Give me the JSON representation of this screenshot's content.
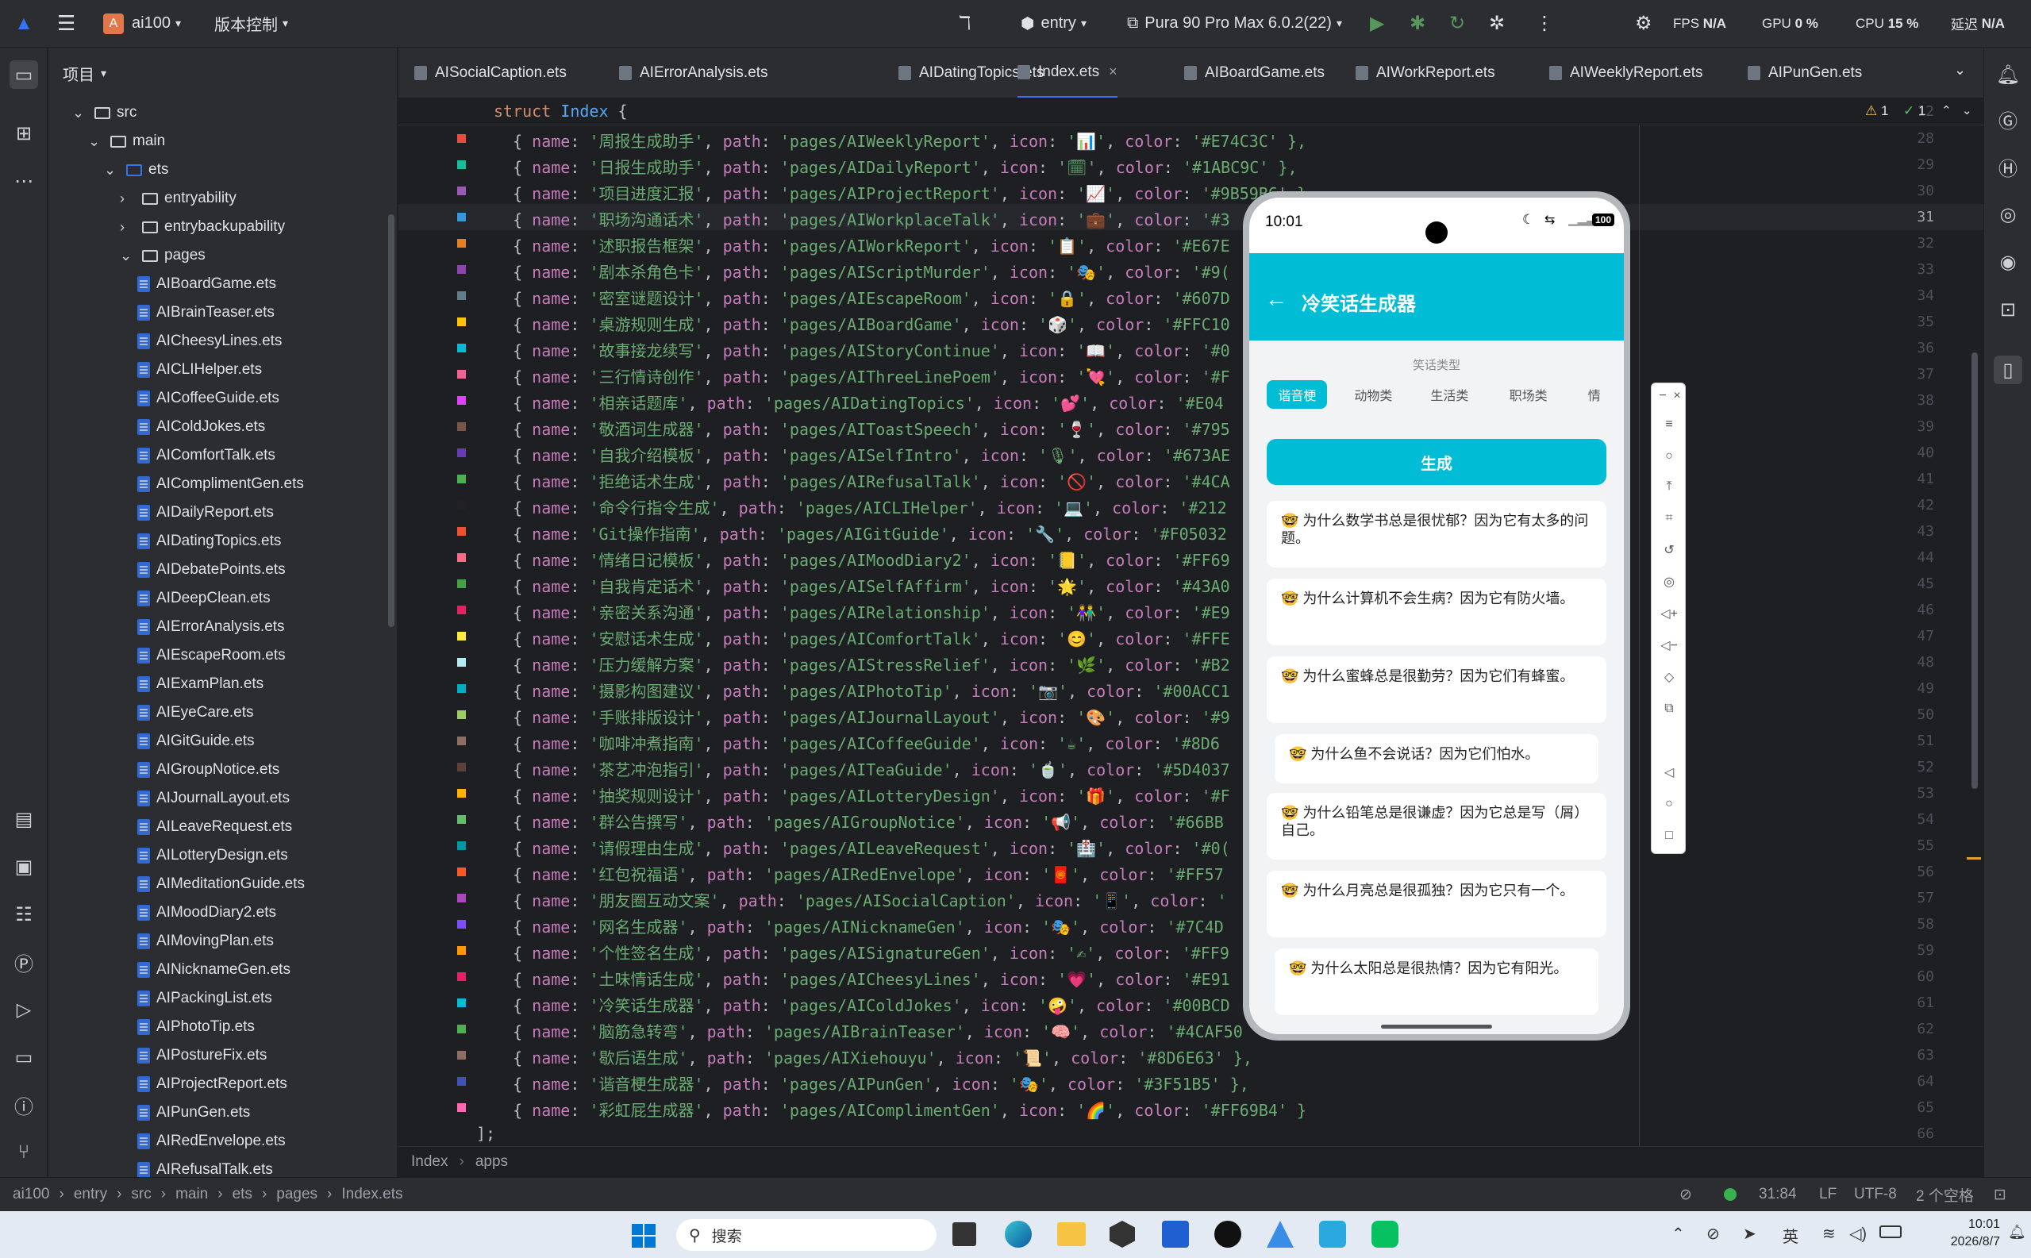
{
  "topbar": {
    "project_badge": "A",
    "project_name": "ai100",
    "vcs": "版本控制",
    "module": "entry",
    "device": "Pura 90 Pro Max 6.0.2(22)",
    "fps_label": "FPS",
    "fps_value": "N/A",
    "gpu_label": "GPU",
    "gpu_value": "0 %",
    "cpu_label": "CPU",
    "cpu_value": "15 %",
    "latency_label": "延迟",
    "latency_value": "N/A"
  },
  "project_panel": {
    "title": "项目",
    "tree": [
      {
        "label": "src",
        "level": 0,
        "type": "folder",
        "open": true
      },
      {
        "label": "main",
        "level": 1,
        "type": "folder",
        "open": true
      },
      {
        "label": "ets",
        "level": 2,
        "type": "folder",
        "open": true
      },
      {
        "label": "entryability",
        "level": 3,
        "type": "folder",
        "open": false
      },
      {
        "label": "entrybackupability",
        "level": 3,
        "type": "folder",
        "open": false
      },
      {
        "label": "pages",
        "level": 3,
        "type": "folder",
        "open": true
      },
      {
        "label": "AIBoardGame.ets",
        "level": 4,
        "type": "file"
      },
      {
        "label": "AIBrainTeaser.ets",
        "level": 4,
        "type": "file"
      },
      {
        "label": "AICheesyLines.ets",
        "level": 4,
        "type": "file"
      },
      {
        "label": "AICLIHelper.ets",
        "level": 4,
        "type": "file"
      },
      {
        "label": "AICoffeeGuide.ets",
        "level": 4,
        "type": "file"
      },
      {
        "label": "AIColdJokes.ets",
        "level": 4,
        "type": "file"
      },
      {
        "label": "AIComfortTalk.ets",
        "level": 4,
        "type": "file"
      },
      {
        "label": "AIComplimentGen.ets",
        "level": 4,
        "type": "file"
      },
      {
        "label": "AIDailyReport.ets",
        "level": 4,
        "type": "file"
      },
      {
        "label": "AIDatingTopics.ets",
        "level": 4,
        "type": "file"
      },
      {
        "label": "AIDebatePoints.ets",
        "level": 4,
        "type": "file"
      },
      {
        "label": "AIDeepClean.ets",
        "level": 4,
        "type": "file"
      },
      {
        "label": "AIErrorAnalysis.ets",
        "level": 4,
        "type": "file"
      },
      {
        "label": "AIEscapeRoom.ets",
        "level": 4,
        "type": "file"
      },
      {
        "label": "AIExamPlan.ets",
        "level": 4,
        "type": "file"
      },
      {
        "label": "AIEyeCare.ets",
        "level": 4,
        "type": "file"
      },
      {
        "label": "AIGitGuide.ets",
        "level": 4,
        "type": "file"
      },
      {
        "label": "AIGroupNotice.ets",
        "level": 4,
        "type": "file"
      },
      {
        "label": "AIJournalLayout.ets",
        "level": 4,
        "type": "file"
      },
      {
        "label": "AILeaveRequest.ets",
        "level": 4,
        "type": "file"
      },
      {
        "label": "AILotteryDesign.ets",
        "level": 4,
        "type": "file"
      },
      {
        "label": "AIMeditationGuide.ets",
        "level": 4,
        "type": "file"
      },
      {
        "label": "AIMoodDiary2.ets",
        "level": 4,
        "type": "file"
      },
      {
        "label": "AIMovingPlan.ets",
        "level": 4,
        "type": "file"
      },
      {
        "label": "AINicknameGen.ets",
        "level": 4,
        "type": "file"
      },
      {
        "label": "AIPackingList.ets",
        "level": 4,
        "type": "file"
      },
      {
        "label": "AIPhotoTip.ets",
        "level": 4,
        "type": "file"
      },
      {
        "label": "AIPostureFix.ets",
        "level": 4,
        "type": "file"
      },
      {
        "label": "AIProjectReport.ets",
        "level": 4,
        "type": "file"
      },
      {
        "label": "AIPunGen.ets",
        "level": 4,
        "type": "file"
      },
      {
        "label": "AIRedEnvelope.ets",
        "level": 4,
        "type": "file"
      },
      {
        "label": "AIRefusalTalk.ets",
        "level": 4,
        "type": "file"
      }
    ]
  },
  "tabs": [
    {
      "label": "AISocialCaption.ets",
      "active": false
    },
    {
      "label": "AIErrorAnalysis.ets",
      "active": false
    },
    {
      "label": "AIDatingTopics.ets",
      "active": false
    },
    {
      "label": "Index.ets",
      "active": true
    },
    {
      "label": "AIBoardGame.ets",
      "active": false
    },
    {
      "label": "AIWorkReport.ets",
      "active": false
    },
    {
      "label": "AIWeeklyReport.ets",
      "active": false
    },
    {
      "label": "AIPunGen.ets",
      "active": false
    }
  ],
  "editor": {
    "sticky_line": "12",
    "sticky_kw": "struct",
    "sticky_name": "Index",
    "warnings": "1",
    "checks": "1",
    "lines": [
      {
        "n": "28",
        "name": "'周报生成助手'",
        "path": "'pages/AIWeeklyReport'",
        "icon": "'📊'",
        "color": "'#E74C3C' },",
        "sw": "#E74C3C"
      },
      {
        "n": "29",
        "name": "'日报生成助手'",
        "path": "'pages/AIDailyReport'",
        "icon": "'🗓'",
        "color": "'#1ABC9C' },",
        "sw": "#1ABC9C"
      },
      {
        "n": "30",
        "name": "'项目进度汇报'",
        "path": "'pages/AIProjectReport'",
        "icon": "'📈'",
        "color": "'#9B59B6' },",
        "sw": "#9B59B6"
      },
      {
        "n": "31",
        "name": "'职场沟通话术'",
        "path": "'pages/AIWorkplaceTalk'",
        "icon": "'💼'",
        "color": "'#3",
        "sw": "#3498DB"
      },
      {
        "n": "32",
        "name": "'述职报告框架'",
        "path": "'pages/AIWorkReport'",
        "icon": "'📋'",
        "color": "'#E67E",
        "sw": "#E67E22"
      },
      {
        "n": "33",
        "name": "'剧本杀角色卡'",
        "path": "'pages/AIScriptMurder'",
        "icon": "'🎭'",
        "color": "'#9(",
        "sw": "#8E44AD"
      },
      {
        "n": "34",
        "name": "'密室谜题设计'",
        "path": "'pages/AIEscapeRoom'",
        "icon": "'🔒'",
        "color": "'#607D",
        "sw": "#607D8B"
      },
      {
        "n": "35",
        "name": "'桌游规则生成'",
        "path": "'pages/AIBoardGame'",
        "icon": "'🎲'",
        "color": "'#FFC10",
        "sw": "#FFC107"
      },
      {
        "n": "36",
        "name": "'故事接龙续写'",
        "path": "'pages/AIStoryContinue'",
        "icon": "'📖'",
        "color": "'#0",
        "sw": "#00BCD4"
      },
      {
        "n": "37",
        "name": "'三行情诗创作'",
        "path": "'pages/AIThreeLinePoem'",
        "icon": "'💘'",
        "color": "'#F",
        "sw": "#F06292"
      },
      {
        "n": "38",
        "name": "'相亲话题库'",
        "path": "'pages/AIDatingTopics'",
        "icon": "'💕'",
        "color": "'#E04",
        "sw": "#E040FB"
      },
      {
        "n": "39",
        "name": "'敬酒词生成器'",
        "path": "'pages/AIToastSpeech'",
        "icon": "'🍷'",
        "color": "'#795",
        "sw": "#795548"
      },
      {
        "n": "40",
        "name": "'自我介绍模板'",
        "path": "'pages/AISelfIntro'",
        "icon": "'🎙'",
        "color": "'#673AE",
        "sw": "#673AB7"
      },
      {
        "n": "41",
        "name": "'拒绝话术生成'",
        "path": "'pages/AIRefusalTalk'",
        "icon": "'🚫'",
        "color": "'#4CA",
        "sw": "#4CAF50"
      },
      {
        "n": "42",
        "name": "'命令行指令生成'",
        "path": "'pages/AICLIHelper'",
        "icon": "'💻'",
        "color": "'#212",
        "sw": "#212121"
      },
      {
        "n": "43",
        "name": "'Git操作指南'",
        "path": "'pages/AIGitGuide'",
        "icon": "'🔧'",
        "color": "'#F05032",
        "sw": "#F05032"
      },
      {
        "n": "44",
        "name": "'情绪日记模板'",
        "path": "'pages/AIMoodDiary2'",
        "icon": "'📒'",
        "color": "'#FF69",
        "sw": "#FF6984"
      },
      {
        "n": "45",
        "name": "'自我肯定话术'",
        "path": "'pages/AISelfAffirm'",
        "icon": "'🌟'",
        "color": "'#43A0",
        "sw": "#43A047"
      },
      {
        "n": "46",
        "name": "'亲密关系沟通'",
        "path": "'pages/AIRelationship'",
        "icon": "'👫'",
        "color": "'#E9",
        "sw": "#E91E63"
      },
      {
        "n": "47",
        "name": "'安慰话术生成'",
        "path": "'pages/AIComfortTalk'",
        "icon": "'😊'",
        "color": "'#FFE",
        "sw": "#FFEB3B"
      },
      {
        "n": "48",
        "name": "'压力缓解方案'",
        "path": "'pages/AIStressRelief'",
        "icon": "'🌿'",
        "color": "'#B2",
        "sw": "#B2EBF2"
      },
      {
        "n": "49",
        "name": "'摄影构图建议'",
        "path": "'pages/AIPhotoTip'",
        "icon": "'📷'",
        "color": "'#00ACC1",
        "sw": "#00ACC1"
      },
      {
        "n": "50",
        "name": "'手账排版设计'",
        "path": "'pages/AIJournalLayout'",
        "icon": "'🎨'",
        "color": "'#9",
        "sw": "#9CCC65"
      },
      {
        "n": "51",
        "name": "'咖啡冲煮指南'",
        "path": "'pages/AICoffeeGuide'",
        "icon": "'☕'",
        "color": "'#8D6",
        "sw": "#8D6E63"
      },
      {
        "n": "52",
        "name": "'茶艺冲泡指引'",
        "path": "'pages/AITeaGuide'",
        "icon": "'🍵'",
        "color": "'#5D4037",
        "sw": "#5D4037"
      },
      {
        "n": "53",
        "name": "'抽奖规则设计'",
        "path": "'pages/AILotteryDesign'",
        "icon": "'🎁'",
        "color": "'#F",
        "sw": "#FFB300"
      },
      {
        "n": "54",
        "name": "'群公告撰写'",
        "path": "'pages/AIGroupNotice'",
        "icon": "'📢'",
        "color": "'#66BB",
        "sw": "#66BB6A"
      },
      {
        "n": "55",
        "name": "'请假理由生成'",
        "path": "'pages/AILeaveRequest'",
        "icon": "'🏥'",
        "color": "'#0(",
        "sw": "#0097A7"
      },
      {
        "n": "56",
        "name": "'红包祝福语'",
        "path": "'pages/AIRedEnvelope'",
        "icon": "'🧧'",
        "color": "'#FF57",
        "sw": "#FF5722"
      },
      {
        "n": "57",
        "name": "'朋友圈互动文案'",
        "path": "'pages/AISocialCaption'",
        "icon": "'📱'",
        "color": "'",
        "sw": "#AB47BC"
      },
      {
        "n": "58",
        "name": "'网名生成器'",
        "path": "'pages/AINicknameGen'",
        "icon": "'🎭'",
        "color": "'#7C4D",
        "sw": "#7C4DFF"
      },
      {
        "n": "59",
        "name": "'个性签名生成'",
        "path": "'pages/AISignatureGen'",
        "icon": "'✍'",
        "color": "'#FF9",
        "sw": "#FF9800"
      },
      {
        "n": "60",
        "name": "'土味情话生成'",
        "path": "'pages/AICheesyLines'",
        "icon": "'💗'",
        "color": "'#E91",
        "sw": "#E91E63"
      },
      {
        "n": "61",
        "name": "'冷笑话生成器'",
        "path": "'pages/AIColdJokes'",
        "icon": "'🤪'",
        "color": "'#00BCD",
        "sw": "#00BCD4"
      },
      {
        "n": "62",
        "name": "'脑筋急转弯'",
        "path": "'pages/AIBrainTeaser'",
        "icon": "'🧠'",
        "color": "'#4CAF50",
        "sw": "#4CAF50"
      },
      {
        "n": "63",
        "name": "'歇后语生成'",
        "path": "'pages/AIXiehouyu'",
        "icon": "'📜'",
        "color": "'#8D6E63' },",
        "sw": "#8D6E63"
      },
      {
        "n": "64",
        "name": "'谐音梗生成器'",
        "path": "'pages/AIPunGen'",
        "icon": "'🎭'",
        "color": "'#3F51B5' },",
        "sw": "#3F51B5"
      },
      {
        "n": "65",
        "name": "'彩虹屁生成器'",
        "path": "'pages/AIComplimentGen'",
        "icon": "'🌈'",
        "color": "'#FF69B4' }",
        "sw": "#FF69B4"
      },
      {
        "n": "66",
        "tail": "];"
      }
    ]
  },
  "breadcrumb": [
    "Index",
    "apps"
  ],
  "status": {
    "path": [
      "ai100",
      "entry",
      "src",
      "main",
      "ets",
      "pages",
      "Index.ets"
    ],
    "position": "31:84",
    "line_sep": "LF",
    "encoding": "UTF-8",
    "indent": "2 个空格"
  },
  "phone": {
    "time": "10:01",
    "battery": "100",
    "title": "冷笑话生成器",
    "section_label": "笑话类型",
    "chips": [
      "谐音梗",
      "动物类",
      "生活类",
      "职场类",
      "情"
    ],
    "generate": "生成",
    "accent": "#00BCD4",
    "jokes": [
      "🤓 为什么数学书总是很忧郁？因为它有太多的问题。",
      "🤓 为什么计算机不会生病？因为它有防火墙。",
      "🤓 为什么蜜蜂总是很勤劳？因为它们有蜂蜜。",
      "🤓 为什么鱼不会说话？因为它们怕水。",
      "🤓 为什么铅笔总是很谦虚？因为它总是写（屑）自己。",
      "🤓 为什么月亮总是很孤独？因为它只有一个。",
      "🤓 为什么太阳总是很热情？因为它有阳光。"
    ]
  },
  "taskbar": {
    "search": "搜索",
    "ime": "英",
    "time": "10:01",
    "date": "2026/8/7"
  }
}
